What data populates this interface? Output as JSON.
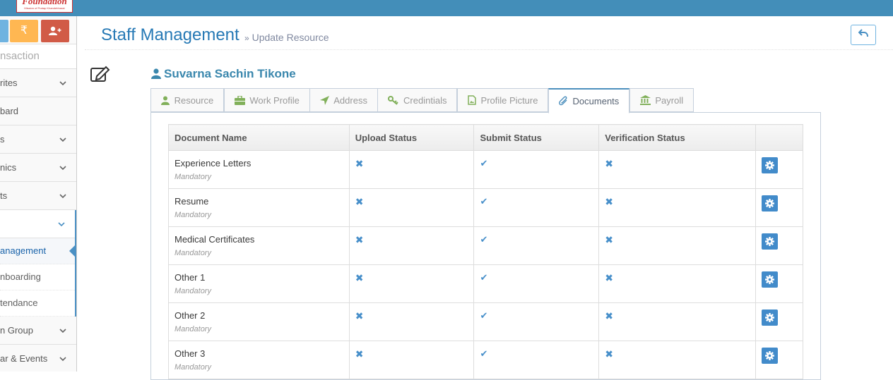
{
  "logo": {
    "title": "Foundation",
    "tagline": "Mission of Pratap Khandebharat"
  },
  "sidebar": {
    "shortcuts": [
      {
        "icon": "shortcut-blue-icon",
        "color": "#6fb3e0"
      },
      {
        "icon": "rupee-icon",
        "color": "#ffb752",
        "glyph": "₹"
      },
      {
        "icon": "user-add-icon",
        "color": "#d15b47"
      }
    ],
    "search_text": "nsaction",
    "items": [
      {
        "label": "rites",
        "chevron": true
      },
      {
        "label": "bard",
        "chevron": false
      },
      {
        "label": "s",
        "chevron": true
      },
      {
        "label": "nics",
        "chevron": true
      },
      {
        "label": "ts",
        "chevron": true
      },
      {
        "label": "",
        "chevron": true,
        "open": true
      }
    ],
    "sub_items": [
      {
        "label": "anagement",
        "active": true
      },
      {
        "label": "nboarding",
        "active": false
      },
      {
        "label": "tendance",
        "active": false
      }
    ],
    "items_after": [
      {
        "label": "n Group",
        "chevron": true
      },
      {
        "label": "ar & Events",
        "chevron": true
      }
    ]
  },
  "breadcrumb": {
    "title": "Staff Management",
    "separator": "»",
    "subtitle": "Update Resource"
  },
  "user": {
    "name": "Suvarna Sachin Tikone"
  },
  "tabs": [
    {
      "label": "Resource",
      "icon": "user-icon",
      "active": false
    },
    {
      "label": "Work Profile",
      "icon": "briefcase-icon",
      "active": false
    },
    {
      "label": "Address",
      "icon": "location-arrow-icon",
      "active": false
    },
    {
      "label": "Credintials",
      "icon": "key-icon",
      "active": false
    },
    {
      "label": "Profile Picture",
      "icon": "picture-icon",
      "active": false
    },
    {
      "label": "Documents",
      "icon": "paperclip-icon",
      "active": true
    },
    {
      "label": "Payroll",
      "icon": "bank-icon",
      "active": false
    }
  ],
  "table": {
    "headers": [
      "Document Name",
      "Upload Status",
      "Submit Status",
      "Verification Status",
      ""
    ],
    "rows": [
      {
        "name": "Experience Letters",
        "note": "Mandatory",
        "upload": "✖",
        "submit": "✔",
        "verification": "✖"
      },
      {
        "name": "Resume",
        "note": "Mandatory",
        "upload": "✖",
        "submit": "✔",
        "verification": "✖"
      },
      {
        "name": "Medical Certificates",
        "note": "Mandatory",
        "upload": "✖",
        "submit": "✔",
        "verification": "✖"
      },
      {
        "name": "Other 1",
        "note": "Mandatory",
        "upload": "✖",
        "submit": "✔",
        "verification": "✖"
      },
      {
        "name": "Other 2",
        "note": "Mandatory",
        "upload": "✖",
        "submit": "✔",
        "verification": "✖"
      },
      {
        "name": "Other 3",
        "note": "Mandatory",
        "upload": "✖",
        "submit": "✔",
        "verification": "✖"
      }
    ]
  },
  "colors": {
    "topbar": "#438eb9",
    "accent": "#4a90c4",
    "tab_icon": "#81b05a",
    "action_button": "#428bca"
  }
}
